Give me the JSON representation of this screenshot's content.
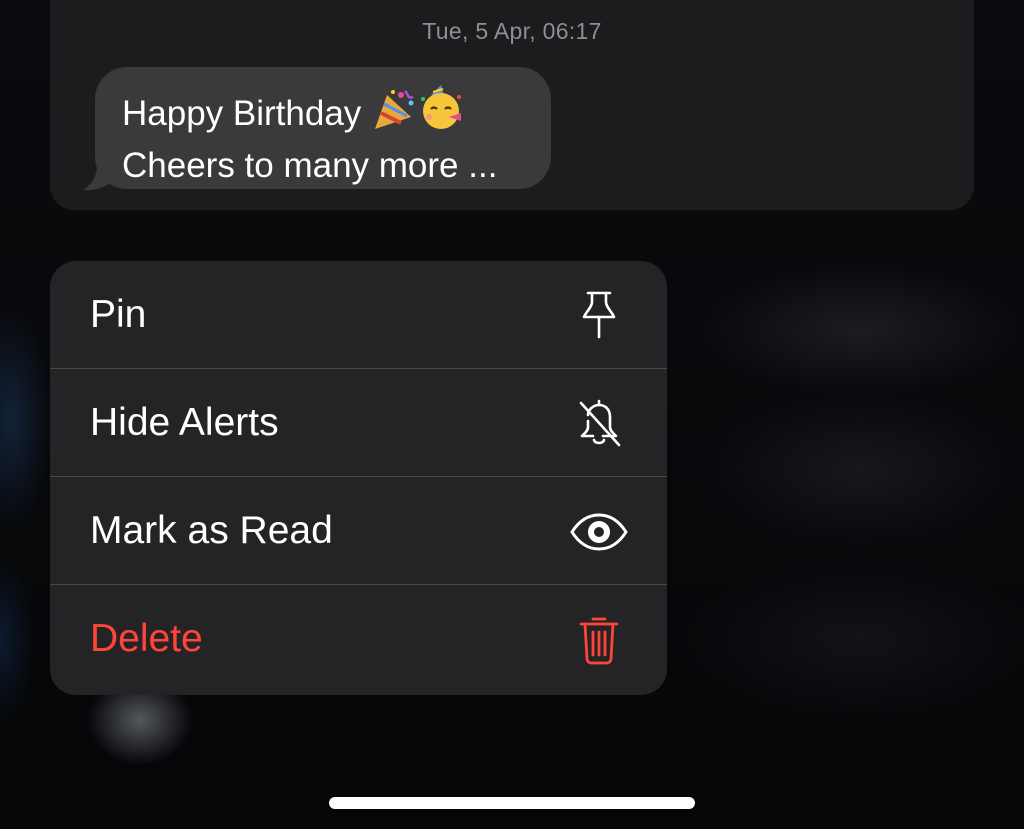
{
  "message_preview": {
    "timestamp": "Tue, 5 Apr, 06:17",
    "lines": [
      "Happy Birthday",
      "Cheers to many more ..."
    ],
    "emojis": [
      "party-popper-emoji",
      "partying-face-emoji"
    ]
  },
  "context_menu": {
    "items": [
      {
        "label": "Pin",
        "icon": "pin-icon"
      },
      {
        "label": "Hide Alerts",
        "icon": "bell-slash-icon"
      },
      {
        "label": "Mark as Read",
        "icon": "eye-icon"
      },
      {
        "label": "Delete",
        "icon": "trash-icon",
        "destructive": true
      }
    ]
  },
  "colors": {
    "destructive": "#ff453a",
    "menu_background": "#242426",
    "bubble_background": "#3a3a3c",
    "card_background": "#1c1c1e",
    "timestamp": "#8e8e93"
  }
}
